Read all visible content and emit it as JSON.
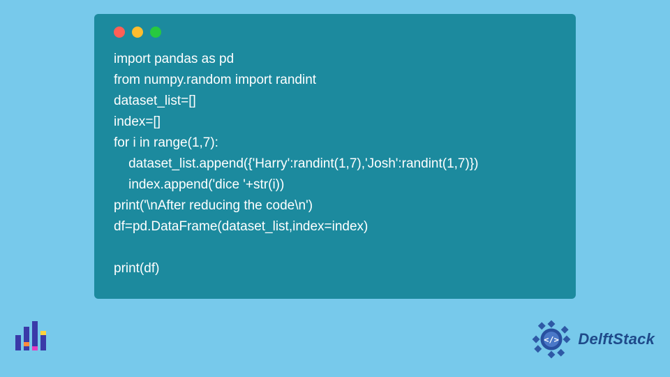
{
  "code": {
    "lines": [
      "import pandas as pd",
      "from numpy.random import randint",
      "dataset_list=[]",
      "index=[]",
      "for i in range(1,7):",
      "    dataset_list.append({'Harry':randint(1,7),'Josh':randint(1,7)})",
      "    index.append('dice '+str(i))",
      "print('\\nAfter reducing the code\\n')",
      "df=pd.DataFrame(dataset_list,index=index)",
      "",
      "print(df)"
    ]
  },
  "brand": {
    "name": "DelftStack"
  },
  "colors": {
    "bg": "#77c9eb",
    "window": "#1c8a9e",
    "traffic_red": "#ff5f56",
    "traffic_yellow": "#ffbd2e",
    "traffic_green": "#27c93f",
    "brand_text": "#1e4a8a"
  }
}
